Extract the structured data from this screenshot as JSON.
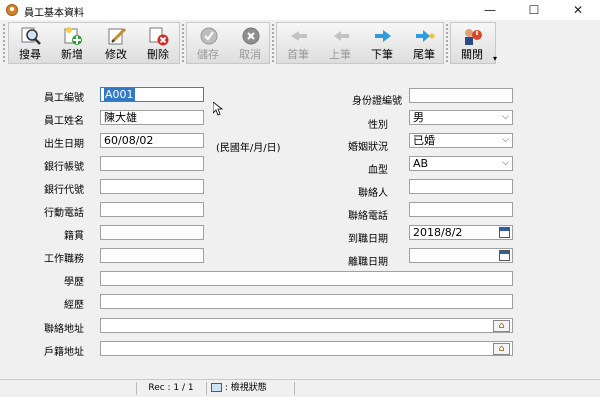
{
  "window": {
    "title": "員工基本資料",
    "min": "—",
    "max": "☐",
    "close": "✕"
  },
  "toolbar": {
    "search": "搜尋",
    "add": "新增",
    "edit": "修改",
    "delete": "刪除",
    "save": "儲存",
    "cancel": "取消",
    "first": "首筆",
    "prev": "上筆",
    "next": "下筆",
    "last": "尾筆",
    "close": "關閉"
  },
  "form": {
    "emp_no_label": "員工編號",
    "emp_no": "A001",
    "emp_name_label": "員工姓名",
    "emp_name": "陳大雄",
    "birth_label": "出生日期",
    "birth": "60/08/02",
    "birth_hint": "(民國年/月/日)",
    "bank_acct_label": "銀行帳號",
    "bank_acct": "",
    "bank_code_label": "銀行代號",
    "bank_code": "",
    "mobile_label": "行動電話",
    "mobile": "",
    "origin_label": "籍貫",
    "origin": "",
    "job_label": "工作職務",
    "job": "",
    "edu_label": "學歷",
    "edu": "",
    "exp_label": "經歷",
    "exp": "",
    "addr_label": "聯絡地址",
    "addr": "",
    "reg_addr_label": "戶籍地址",
    "reg_addr": "",
    "id_label": "身份證編號",
    "id": "",
    "gender_label": "性別",
    "gender": "男",
    "marital_label": "婚姻狀況",
    "marital": "已婚",
    "blood_label": "血型",
    "blood": "AB",
    "contact_label": "聯絡人",
    "contact": "",
    "contact_phone_label": "聯絡電話",
    "contact_phone": "",
    "hire_label": "到職日期",
    "hire": "2018/8/2",
    "leave_label": "離職日期",
    "leave": ""
  },
  "status": {
    "rec": "Rec : 1 / 1",
    "mode": ": 檢視狀態"
  }
}
